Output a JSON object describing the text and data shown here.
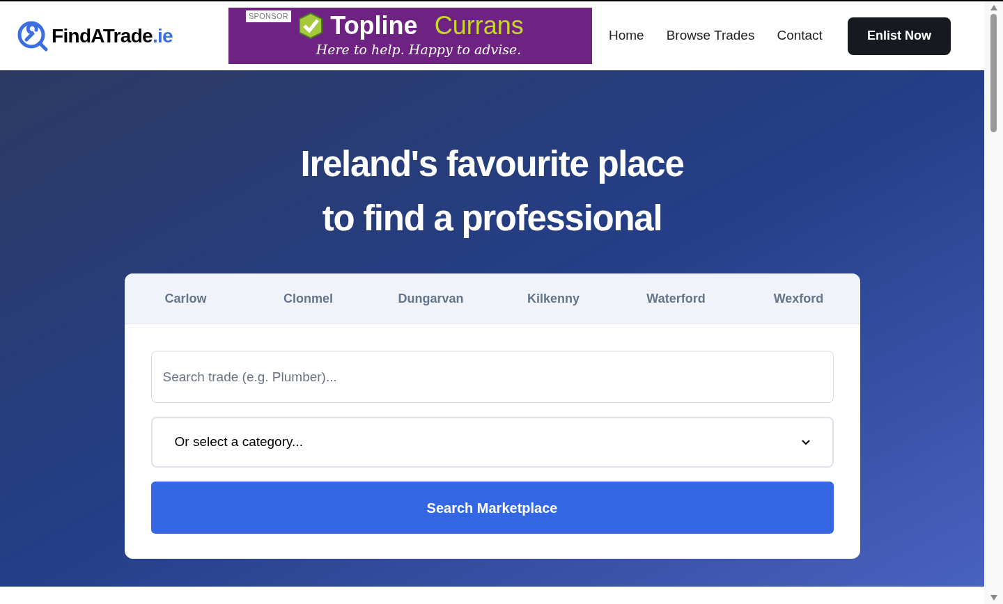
{
  "header": {
    "logo": {
      "name": "FindATrade",
      "tld": ".ie"
    },
    "sponsor": {
      "badge": "SPONSOR",
      "brand": "Topline",
      "partner": "Currans",
      "tagline": "Here to help. Happy to advise."
    },
    "nav": [
      {
        "label": "Home"
      },
      {
        "label": "Browse Trades"
      },
      {
        "label": "Contact"
      }
    ],
    "cta": "Enlist Now"
  },
  "hero": {
    "title_lines": [
      "Ireland's favourite place",
      "to find a professional"
    ]
  },
  "search_card": {
    "tabs": [
      {
        "label": "Carlow",
        "selected": false
      },
      {
        "label": "Clonmel",
        "selected": false
      },
      {
        "label": "Dungarvan",
        "selected": false
      },
      {
        "label": "Kilkenny",
        "selected": false
      },
      {
        "label": "Waterford",
        "selected": false
      },
      {
        "label": "Wexford",
        "selected": false
      }
    ],
    "search": {
      "placeholder": "Search trade (e.g. Plumber)..."
    },
    "category": {
      "value": "Or select a category..."
    },
    "button": "Search Marketplace"
  }
}
